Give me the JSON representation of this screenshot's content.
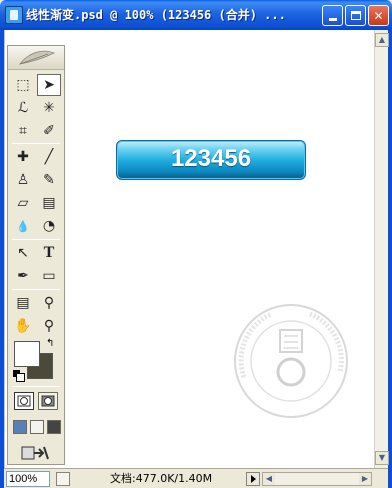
{
  "window": {
    "title": "线性渐变.psd @ 100% (123456 (合并) ...",
    "minimize_label": "",
    "maximize_label": "",
    "close_label": "✕"
  },
  "toolbox": {
    "icons": {
      "marquee": "marquee-icon",
      "move": "move-icon",
      "lasso": "lasso-icon",
      "magic_wand": "magic-wand-icon",
      "crop": "crop-icon",
      "slice": "slice-icon",
      "healing": "healing-brush-icon",
      "brush": "brush-icon",
      "stamp": "clone-stamp-icon",
      "history_brush": "history-brush-icon",
      "eraser": "eraser-icon",
      "gradient": "gradient-icon",
      "blur": "blur-icon",
      "dodge": "dodge-icon",
      "path_select": "path-selection-icon",
      "type": "type-icon",
      "pen": "pen-icon",
      "shape": "shape-icon",
      "notes": "notes-icon",
      "eyedropper": "eyedropper-icon",
      "hand": "hand-icon",
      "zoom": "zoom-icon"
    },
    "glyphs": {
      "marquee": "⬚",
      "move": "➤",
      "lasso": "ℒ",
      "magic_wand": "✳",
      "crop": "⌗",
      "slice": "✐",
      "healing": "✚",
      "brush": "╱",
      "stamp": "♙",
      "history_brush": "✎",
      "eraser": "▱",
      "gradient": "▤",
      "blur": "💧",
      "dodge": "◔",
      "path_select": "↖",
      "type": "T",
      "pen": "✒",
      "shape": "▭",
      "notes": "▤",
      "eyedropper": "⚲",
      "hand": "✋",
      "zoom": "⚲"
    },
    "foreground_color": "#ffffff",
    "background_color": "#4b4a3a",
    "swap_glyph": "↰"
  },
  "canvas": {
    "button_text": "123456",
    "button_colors": [
      "#c7f0fb",
      "#20aee0",
      "#0a5a86"
    ]
  },
  "statusbar": {
    "zoom": "100%",
    "doc_info": "文档:477.0K/1.40M"
  }
}
